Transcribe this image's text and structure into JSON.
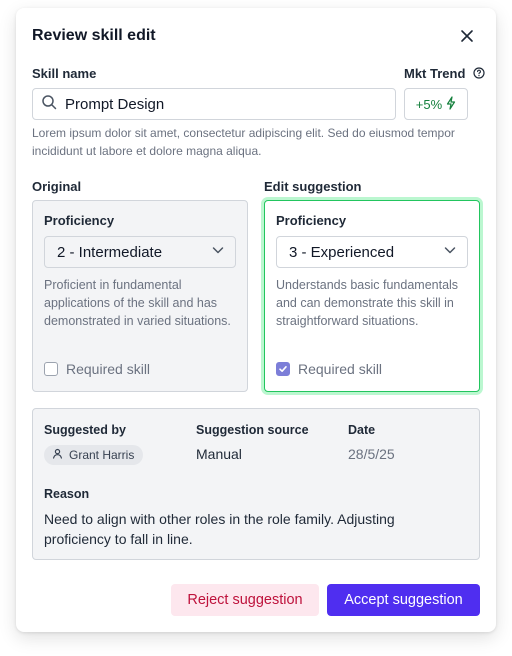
{
  "dialog": {
    "title": "Review skill edit"
  },
  "skill": {
    "label": "Skill name",
    "value": "Prompt Design",
    "description": "Lorem ipsum dolor sit amet, consectetur adipiscing elit. Sed do eiusmod tempor incididunt ut labore et dolore magna aliqua."
  },
  "trend": {
    "label": "Mkt Trend",
    "value": "+5%",
    "color": "#15803d"
  },
  "original": {
    "heading": "Original",
    "proficiency_label": "Proficiency",
    "proficiency_value": "2 - Intermediate",
    "description": "Proficient in fundamental applications of the skill and has demonstrated in varied situations.",
    "required_label": "Required skill",
    "required_checked": false
  },
  "suggestion": {
    "heading": "Edit suggestion",
    "proficiency_label": "Proficiency",
    "proficiency_value": "3 - Experienced",
    "description": "Understands basic fundamentals and can demonstrate this skill in straightforward situations.",
    "required_label": "Required skill",
    "required_checked": true,
    "highlight_color": "#22c55e"
  },
  "details": {
    "suggested_by_label": "Suggested by",
    "suggested_by_value": "Grant Harris",
    "source_label": "Suggestion source",
    "source_value": "Manual",
    "date_label": "Date",
    "date_value": "28/5/25",
    "reason_label": "Reason",
    "reason_value": "Need to align with other roles in the role family.  Adjusting proficiency to fall in line."
  },
  "actions": {
    "reject_label": "Reject suggestion",
    "accept_label": "Accept suggestion",
    "accept_color": "#4f2ef0",
    "reject_color": "#be123c"
  }
}
